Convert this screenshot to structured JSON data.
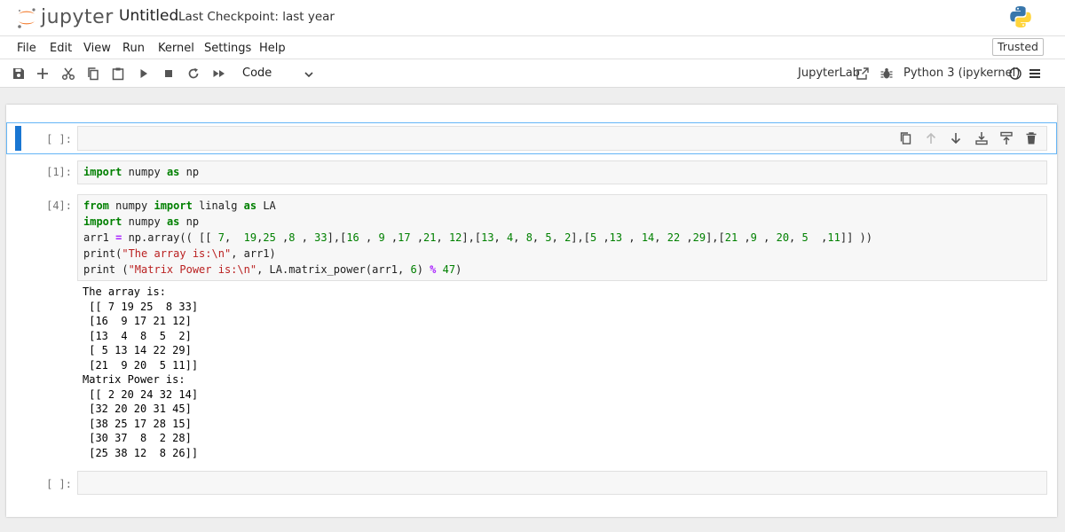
{
  "header": {
    "logo_text": "jupyter",
    "notebook_title": "Untitled",
    "checkpoint": "Last Checkpoint: last year"
  },
  "menu": {
    "items": [
      "File",
      "Edit",
      "View",
      "Run",
      "Kernel",
      "Settings",
      "Help"
    ],
    "trusted": "Trusted"
  },
  "toolbar": {
    "icons": [
      "save-icon",
      "add-cell-icon",
      "cut-icon",
      "copy-icon",
      "paste-icon",
      "run-icon",
      "stop-icon",
      "restart-icon",
      "run-all-icon"
    ],
    "cell_type": "Code",
    "jupyterlab": "JupyterLab",
    "kernel": "Python 3 (ipykernel)"
  },
  "cells": {
    "active_prompt": "[ ]:",
    "cell1": {
      "prompt": "[1]:",
      "line1": {
        "k1": "import",
        "t1": " numpy ",
        "k2": "as",
        "t2": " np"
      }
    },
    "cell2": {
      "prompt": "[4]:",
      "line1": {
        "k1": "from",
        "t1": " numpy ",
        "k2": "import",
        "t2": " linalg ",
        "k3": "as",
        "t3": " LA"
      },
      "line2": {
        "k1": "import",
        "t1": " numpy ",
        "k2": "as",
        "t2": " np"
      },
      "line3": {
        "a": "arr1 ",
        "eq": "=",
        "b": " np.array(( [[ ",
        "n1": "7",
        "c1": ",  ",
        "n2": "19",
        "c2": ",",
        "n3": "25",
        "c3": " ,",
        "n4": "8",
        "c4": " , ",
        "n5": "33",
        "c5": "],[",
        "n6": "16",
        "c6": " , ",
        "n7": "9",
        "c7": " ,",
        "n8": "17",
        "c8": " ,",
        "n9": "21",
        "c9": ", ",
        "n10": "12",
        "c10": "],[",
        "n11": "13",
        "c11": ", ",
        "n12": "4",
        "c12": ", ",
        "n13": "8",
        "c13": ", ",
        "n14": "5",
        "c14": ", ",
        "n15": "2",
        "c15": "],[",
        "n16": "5",
        "c16": " ,",
        "n17": "13",
        "c17": " , ",
        "n18": "14",
        "c18": ", ",
        "n19": "22",
        "c19": " ,",
        "n20": "29",
        "c20": "],[",
        "n21": "21",
        "c21": " ,",
        "n22": "9",
        "c22": " , ",
        "n23": "20",
        "c23": ", ",
        "n24": "5",
        "c24": "  ,",
        "n25": "11",
        "c25": "]] ))"
      },
      "line4": {
        "a": "print(",
        "s": "\"The array is:\\n\"",
        "b": ", arr1)"
      },
      "line5": {
        "a": "print (",
        "s": "\"Matrix Power is:\\n\"",
        "b": ", LA.matrix_power(arr1, ",
        "n1": "6",
        "c": ") ",
        "op": "%",
        "sp": " ",
        "n2": "47",
        "e": ")"
      },
      "output": [
        "The array is:",
        " [[ 7 19 25  8 33]",
        " [16  9 17 21 12]",
        " [13  4  8  5  2]",
        " [ 5 13 14 22 29]",
        " [21  9 20  5 11]]",
        "Matrix Power is:",
        " [[ 2 20 24 32 14]",
        " [32 20 20 31 45]",
        " [38 25 17 28 15]",
        " [30 37  8  2 28]",
        " [25 38 12  8 26]]"
      ]
    },
    "cell3": {
      "prompt": "[ ]:"
    }
  },
  "colors": {
    "accent": "#1976d2",
    "keyword": "#008000",
    "string": "#ba2121",
    "operator": "#aa22ff"
  }
}
